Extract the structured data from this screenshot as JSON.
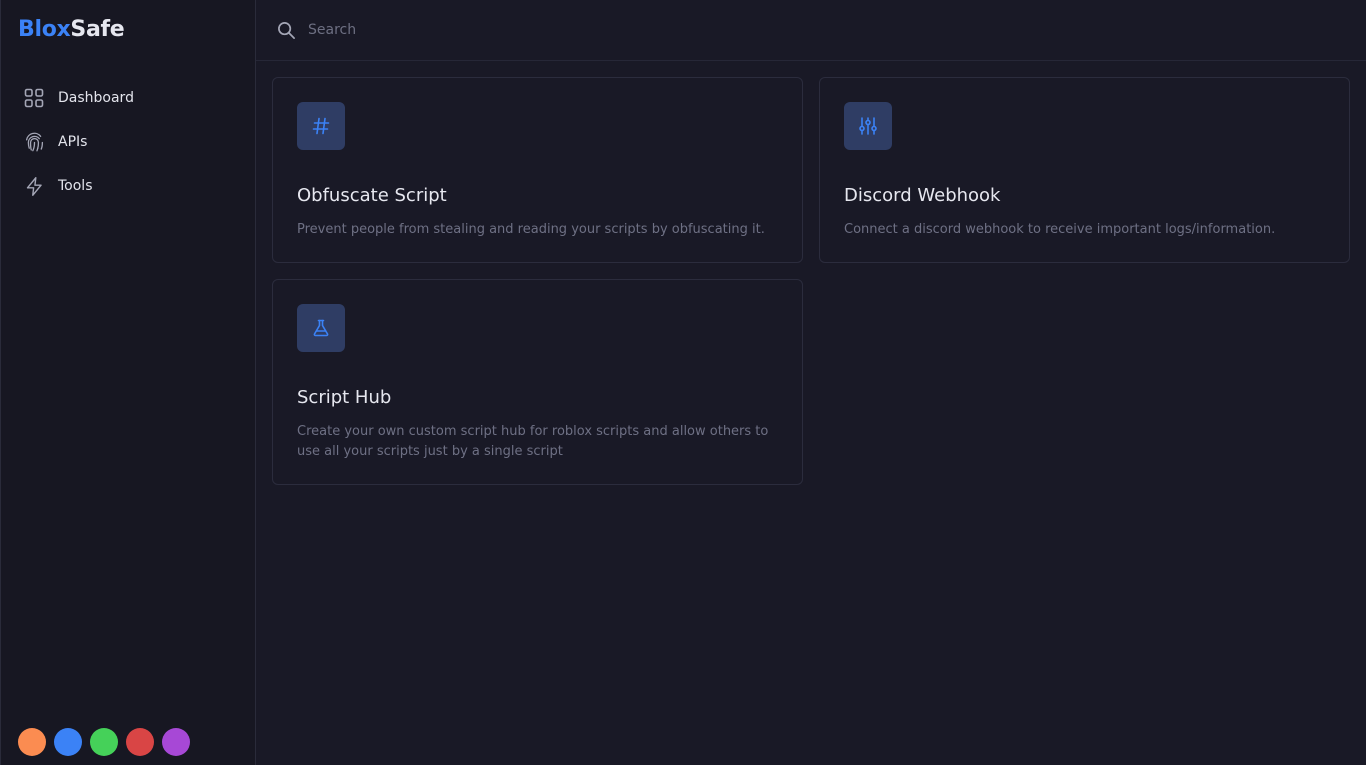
{
  "brand": {
    "part1": "Blox",
    "part2": "Safe"
  },
  "nav": [
    {
      "label": "Dashboard",
      "icon": "grid-icon"
    },
    {
      "label": "APIs",
      "icon": "fingerprint-icon"
    },
    {
      "label": "Tools",
      "icon": "lightning-icon"
    }
  ],
  "search": {
    "placeholder": "Search",
    "value": ""
  },
  "cards": [
    {
      "title": "Obfuscate Script",
      "description": "Prevent people from stealing and reading your scripts by obfuscating it.",
      "icon": "hash-icon"
    },
    {
      "title": "Discord Webhook",
      "description": "Connect a discord webhook to receive important logs/information.",
      "icon": "sliders-icon"
    },
    {
      "title": "Script Hub",
      "description": "Create your own custom script hub for roblox scripts and allow others to use all your scripts just by a single script",
      "icon": "flask-icon"
    }
  ],
  "theme_swatches": [
    "#fb8c51",
    "#3b82f6",
    "#45d159",
    "#d94545",
    "#a748d6"
  ],
  "colors": {
    "accent": "#3b82f6",
    "background": "#191926",
    "sidebar": "#171722",
    "icon_tile": "#2f3d64"
  }
}
